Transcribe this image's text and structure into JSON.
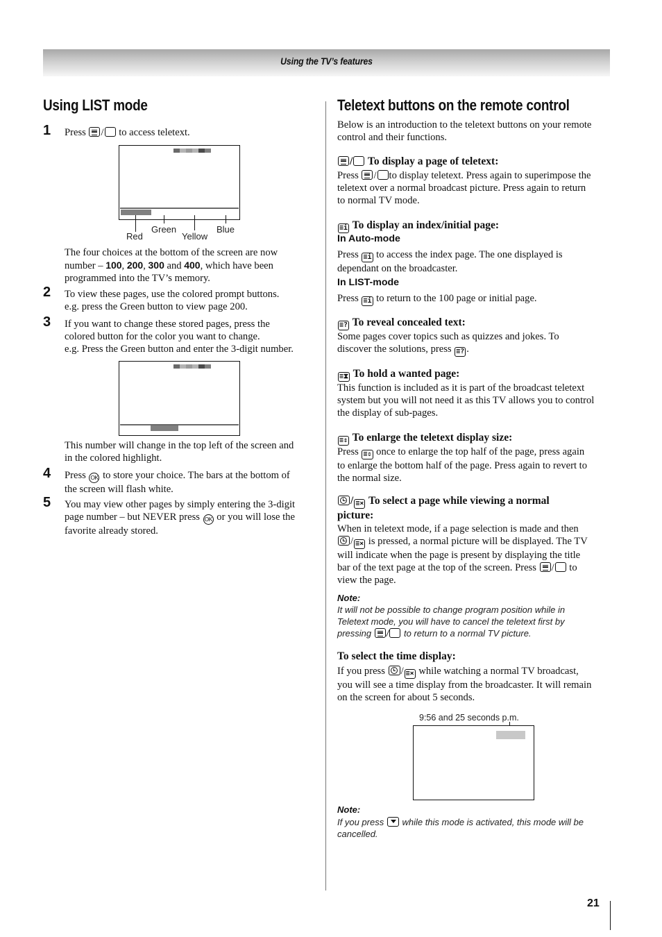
{
  "header": {
    "section_title": "Using the TV’s features"
  },
  "page_number": "21",
  "left": {
    "title": "Using LIST mode",
    "steps": [
      {
        "num": "1",
        "pre": "Press",
        "post": "to access teletext."
      },
      {
        "num": "2",
        "line1": "To view these pages, use the colored prompt buttons.",
        "line2": "e.g. press the Green button to view page 200."
      },
      {
        "num": "3",
        "line1": "If you want to change these stored pages, press the",
        "line2": "colored button for the color you want to change.",
        "line3": "e.g. Press the Green button and enter the 3-digit number."
      },
      {
        "num": "4",
        "pre": "Press",
        "post": "to store your choice. The bars at the bottom of",
        "line2": "the screen will flash white."
      },
      {
        "num": "5",
        "line1": "You may view other pages by simply entering the 3-digit",
        "pre2": "page number – but NEVER press",
        "post2": "or you will lose the",
        "line3": "favorite already stored."
      }
    ],
    "diagram1": {
      "labels": {
        "red": "Red",
        "green": "Green",
        "yellow": "Yellow",
        "blue": "Blue"
      },
      "highlighted": "Red"
    },
    "choices_para": {
      "line1": "The four choices at the bottom of the screen are now",
      "line2_pre": "number – ",
      "pages": [
        "100",
        "200",
        "300",
        "400"
      ],
      "sep1": ", ",
      "sep2": ", ",
      "sep3": " and ",
      "line2_post": ", which have been",
      "line3": "programmed into the TV’s memory."
    },
    "diagram2": {
      "highlighted": "Green"
    },
    "change_para": {
      "line1": "This number will change in the top left of the screen and",
      "line2": "in the colored highlight."
    },
    "ok_label": "OK"
  },
  "right": {
    "title": "Teletext buttons on the remote control",
    "intro": {
      "line1": "Below is an introduction to the teletext buttons on your remote",
      "line2": "control and their functions."
    },
    "sections": {
      "display": {
        "heading": "To display a page of teletext:",
        "pre": "Press",
        "post": "to display teletext. Press again to superimpose the",
        "line2": "teletext over a normal broadcast picture. Press again to return",
        "line3": "to normal TV mode."
      },
      "index": {
        "icon_text": "≡i",
        "heading": "To display an index/initial page:",
        "auto_label": "In Auto-mode",
        "auto_pre": "Press",
        "auto_post": "to access the index page. The one displayed is",
        "auto_line2": "dependant on the broadcaster.",
        "list_label": "In LIST-mode",
        "list_pre": "Press",
        "list_post": "to return to the 100 page or initial page."
      },
      "reveal": {
        "icon_text": "≡?",
        "heading": "To reveal concealed text:",
        "line1": "Some pages cover topics such as quizzes and jokes. To",
        "line2_pre": "discover the solutions, press",
        "line2_post": "."
      },
      "hold": {
        "icon_text": "≡⧗",
        "heading": "To hold a wanted page:",
        "line1": "This function is included as it is part of the broadcast teletext",
        "line2": "system but you will not need it as this TV allows you to control",
        "line3": "the display of sub-pages."
      },
      "enlarge": {
        "icon_text": "≡⇕",
        "heading": "To enlarge the teletext display size:",
        "pre": "Press",
        "post": "once to enlarge the top half of the page, press again",
        "line2": "to enlarge the bottom half of the page. Press again to revert to",
        "line3": "the normal size."
      },
      "select": {
        "icon_text": "≡×",
        "heading_line1": "To select a page while viewing a normal",
        "heading_line2": "picture:",
        "line1": "When in teletext mode, if a page selection is made and then",
        "line2_post": "is pressed, a normal picture will be displayed. The TV",
        "line3": "will indicate when the page is present by displaying the title",
        "line4_pre": "bar of the text page at the top of the screen. Press",
        "line4_post": "to",
        "line5": "view the page."
      },
      "note1": {
        "title": "Note:",
        "line1": "It will not be possible to change program position while in",
        "line2": "Teletext mode, you will have to cancel the teletext first by",
        "line3_pre": "pressing",
        "line3_post": "to return to a normal TV picture."
      },
      "time": {
        "heading": "To select the time display:",
        "pre": "If you press",
        "post": "while watching a normal TV broadcast,",
        "line2": "you will see a time display from the broadcaster. It will remain",
        "line3": "on the screen for about 5 seconds.",
        "caption": "9:56 and 25 seconds p.m."
      },
      "note2": {
        "title": "Note:",
        "pre": "If you press",
        "post": "while this mode is activated, this mode will be",
        "line2": "cancelled."
      }
    }
  }
}
